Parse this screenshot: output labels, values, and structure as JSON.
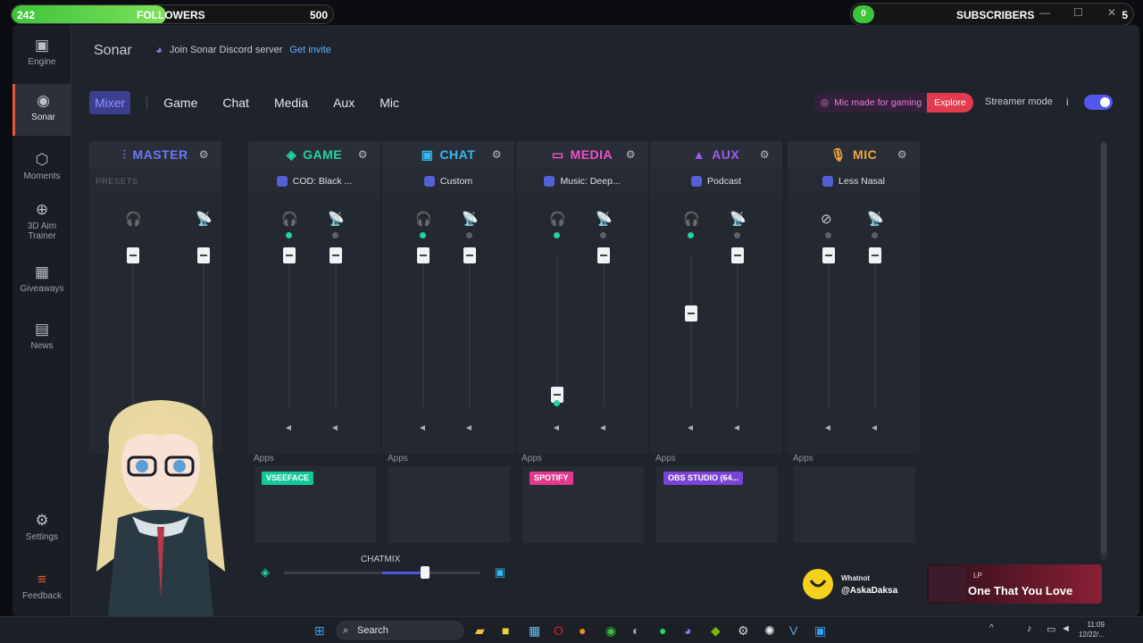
{
  "overlay_left": {
    "current": "242",
    "label": "FOLLOWERS",
    "goal": "500",
    "progress": 0.48
  },
  "overlay_right": {
    "current": "0",
    "label": "SUBSCRIBERS",
    "goal": "5"
  },
  "app": {
    "title": "Sonar"
  },
  "discord": {
    "text": "Join Sonar Discord server",
    "link": "Get invite"
  },
  "sidebar": {
    "items": [
      {
        "label": "Engine",
        "icon": "chip-icon"
      },
      {
        "label": "Sonar",
        "icon": "sonar-icon"
      },
      {
        "label": "Moments",
        "icon": "moments-icon"
      },
      {
        "label": "3D Aim Trainer",
        "icon": "aim-icon"
      },
      {
        "label": "Giveaways",
        "icon": "gift-icon"
      },
      {
        "label": "News",
        "icon": "book-icon"
      },
      {
        "label": "Settings",
        "icon": "gear-icon"
      },
      {
        "label": "Feedback",
        "icon": "feedback-icon"
      }
    ]
  },
  "tabs": [
    "Mixer",
    "Game",
    "Chat",
    "Media",
    "Aux",
    "Mic"
  ],
  "promo": {
    "text": "Mic made for gaming",
    "cta": "Explore"
  },
  "streamer": {
    "label": "Streamer mode",
    "info": "i",
    "enabled": true
  },
  "presets_label": "PRESETS",
  "channels": [
    {
      "name": "MASTER",
      "color": "#6c78f5",
      "preset": "",
      "levels": [
        1.0,
        1.0
      ]
    },
    {
      "name": "GAME",
      "color": "#22d3a4",
      "preset": "COD: Black ...",
      "levels": [
        1.0,
        1.0
      ],
      "app": "VSEEFACE",
      "app_color": "#14c89b"
    },
    {
      "name": "CHAT",
      "color": "#35b9f0",
      "preset": "Custom",
      "levels": [
        1.0,
        1.0
      ]
    },
    {
      "name": "MEDIA",
      "color": "#f04fc8",
      "preset": "Music: Deep...",
      "levels": [
        0.08,
        1.0
      ],
      "app": "SPOTIFY",
      "app_color": "#e0398f"
    },
    {
      "name": "AUX",
      "color": "#9b5cf0",
      "preset": "Podcast",
      "levels": [
        0.62,
        1.0
      ],
      "app": "OBS STUDIO (64...",
      "app_color": "#7b43d6"
    },
    {
      "name": "MIC",
      "color": "#f0a83a",
      "preset": "Less Nasal",
      "levels": [
        1.0,
        1.0
      ]
    }
  ],
  "apps_label": "Apps",
  "chatmix": {
    "label": "CHATMIX",
    "balance": 0.72
  },
  "now_playing": {
    "artist": "LP",
    "title": "One That You Love",
    "fan_name": "Whatnot",
    "fan_handle": "@AskaDaksa"
  },
  "taskbar": {
    "search": "Search",
    "time": "11:09",
    "date": "12/22/..."
  }
}
